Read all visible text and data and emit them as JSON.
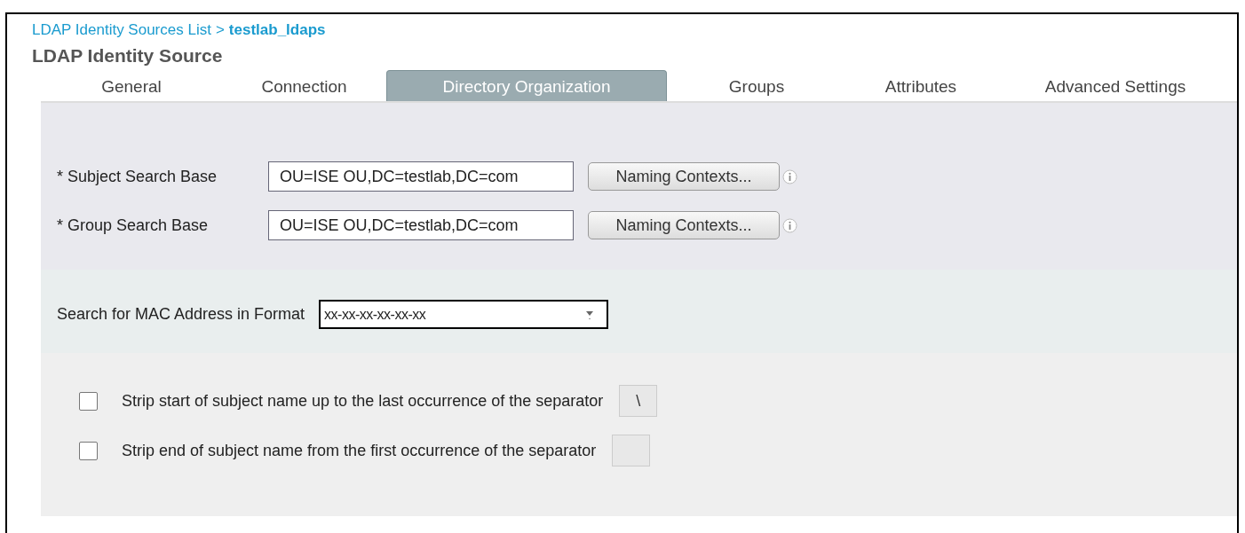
{
  "breadcrumb": {
    "parent": "LDAP Identity Sources List",
    "separator": ">",
    "current": "testlab_ldaps"
  },
  "title": "LDAP Identity Source",
  "tabs": [
    {
      "label": "General",
      "selected": false
    },
    {
      "label": "Connection",
      "selected": false
    },
    {
      "label": "Directory Organization",
      "selected": true
    },
    {
      "label": "Groups",
      "selected": false
    },
    {
      "label": "Attributes",
      "selected": false
    },
    {
      "label": "Advanced Settings",
      "selected": false
    }
  ],
  "search_bases": [
    {
      "label": "* Subject Search Base",
      "value": "OU=ISE OU,DC=testlab,DC=com",
      "button": "Naming Contexts..."
    },
    {
      "label": "* Group Search Base",
      "value": "OU=ISE OU,DC=testlab,DC=com",
      "button": "Naming Contexts..."
    }
  ],
  "mac_format": {
    "label": "Search for MAC Address in Format",
    "value": "xx-xx-xx-xx-xx-xx"
  },
  "strip_options": [
    {
      "label": "Strip start of subject name up to the last occurrence of the separator",
      "checked": false,
      "separator": "\\"
    },
    {
      "label": "Strip end of subject name from the first occurrence of the separator",
      "checked": false
    }
  ]
}
